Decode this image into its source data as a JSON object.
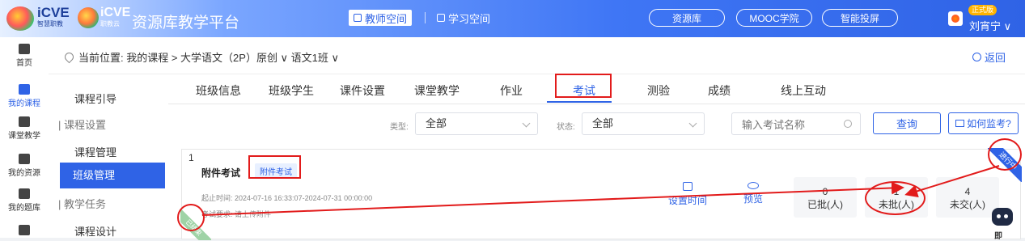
{
  "header": {
    "logo1_text": "iCVE",
    "logo1_sub": "智慧职教",
    "logo2_text": "iCVE",
    "logo2_sub": "职教云",
    "app_title": "资源库教学平台",
    "teacher_space": "教师空间",
    "student_space": "学习空间",
    "pills": [
      "资源库",
      "MOOC学院",
      "智能投屏"
    ],
    "badge": "正式版",
    "username": "刘宵宁 ∨"
  },
  "left_nav": [
    {
      "label": "首页",
      "icon": "home-icon"
    },
    {
      "label": "我的课程",
      "icon": "book-icon"
    },
    {
      "label": "课堂教学",
      "icon": "screen-icon"
    },
    {
      "label": "我的资源",
      "icon": "library-icon"
    },
    {
      "label": "我的题库",
      "icon": "question-bank-icon"
    }
  ],
  "breadcrumb": {
    "prefix": "当前位置: 我的课程 > 大学语文（2P）原创 ∨  语文1班 ∨",
    "back": "返回"
  },
  "sub_nav": {
    "item1": "课程引导",
    "group1": "| 课程设置",
    "item2": "课程管理",
    "item_active": "班级管理",
    "group2": "| 教学任务",
    "item3": "课程设计"
  },
  "tabs": [
    "班级信息",
    "班级学生",
    "课件设置",
    "课堂教学",
    "作业",
    "考试",
    "测验",
    "成绩",
    "线上互动"
  ],
  "active_tab_index": 5,
  "filters": {
    "type_label": "类型:",
    "type_value": "全部",
    "status_label": "状态:",
    "status_value": "全部",
    "search_placeholder": "输入考试名称",
    "query_button": "查询",
    "monitor_button": "如何监考?"
  },
  "exam_card": {
    "index": "1",
    "title": "附件考试",
    "type_tag": "附件考试",
    "time": "起止时间: 2024-07-16 16:33:07-2024-07-31 00:00:00",
    "requirement": "考试要求: 请上传附件",
    "action_set_time": "设置时间",
    "action_preview": "预览",
    "ribbon_status": "进行中",
    "ribbon_corner": "已结束",
    "stats": [
      {
        "value": "0",
        "label": "已批(人)"
      },
      {
        "value": "1",
        "label": "未批(人)"
      },
      {
        "value": "4",
        "label": "未交(人)"
      }
    ]
  },
  "assistant_label": "即",
  "colors": {
    "accent": "#2f63e6",
    "annotation_red": "#e21b1b"
  }
}
